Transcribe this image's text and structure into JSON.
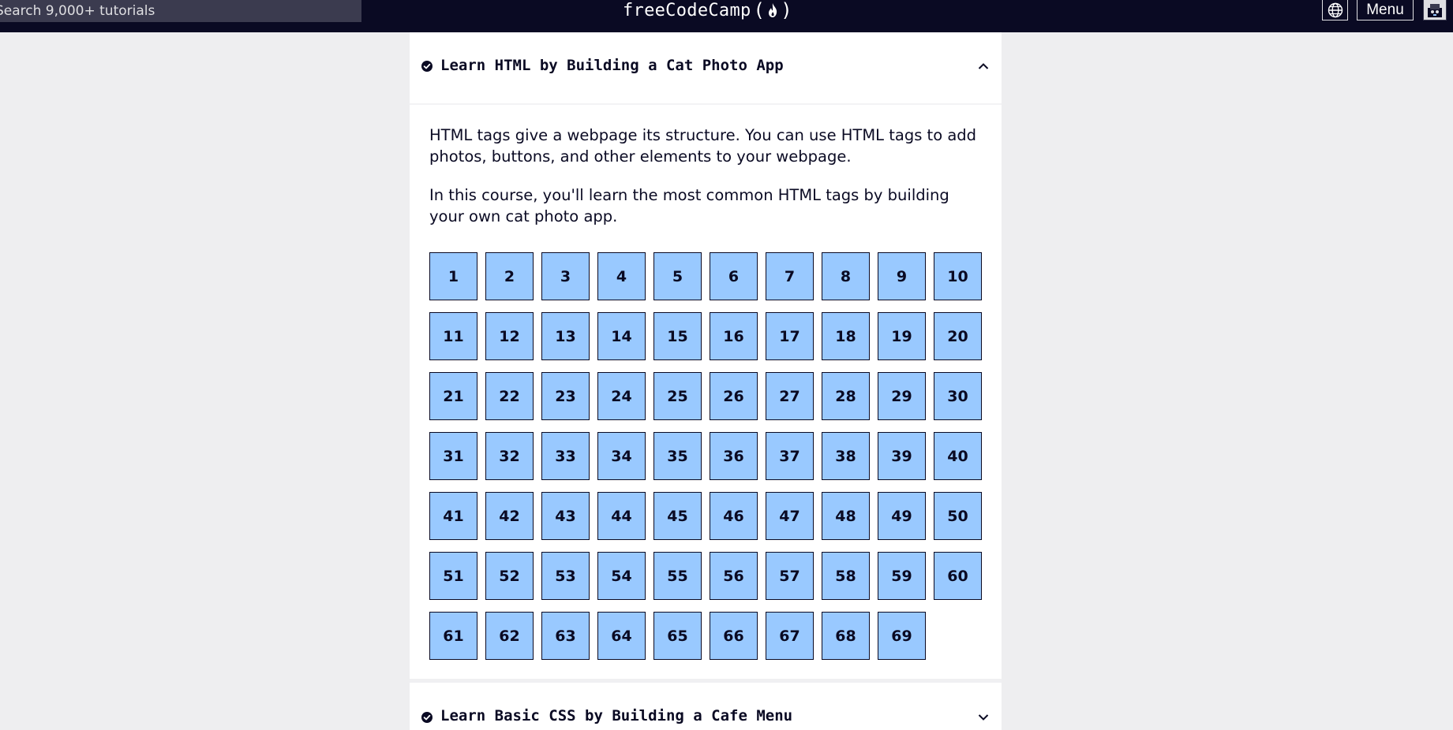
{
  "nav": {
    "search_placeholder": "Search 9,000+ tutorials",
    "brand_text": "freeCodeCamp",
    "brand_open": "(",
    "brand_close": ")",
    "menu_label": "Menu"
  },
  "block": {
    "title": "Learn HTML by Building a Cat Photo App",
    "expanded": true,
    "completed": true,
    "intro": [
      "HTML tags give a webpage its structure. You can use HTML tags to add photos, buttons, and other elements to your webpage.",
      "In this course, you'll learn the most common HTML tags by building your own cat photo app."
    ],
    "steps": [
      "1",
      "2",
      "3",
      "4",
      "5",
      "6",
      "7",
      "8",
      "9",
      "10",
      "11",
      "12",
      "13",
      "14",
      "15",
      "16",
      "17",
      "18",
      "19",
      "20",
      "21",
      "22",
      "23",
      "24",
      "25",
      "26",
      "27",
      "28",
      "29",
      "30",
      "31",
      "32",
      "33",
      "34",
      "35",
      "36",
      "37",
      "38",
      "39",
      "40",
      "41",
      "42",
      "43",
      "44",
      "45",
      "46",
      "47",
      "48",
      "49",
      "50",
      "51",
      "52",
      "53",
      "54",
      "55",
      "56",
      "57",
      "58",
      "59",
      "60",
      "61",
      "62",
      "63",
      "64",
      "65",
      "66",
      "67",
      "68",
      "69"
    ]
  },
  "next_block": {
    "title": "Learn Basic CSS by Building a Cafe Menu",
    "expanded": false
  },
  "colors": {
    "nav_bg": "#0a0a23",
    "search_bg": "#3b3b4f",
    "step_bg": "#99c9ff",
    "page_bg": "#eeeef0"
  },
  "icons": [
    "flame-icon",
    "globe-icon",
    "avatar-icon",
    "check-circle-icon",
    "caret-up-icon",
    "caret-down-icon"
  ]
}
